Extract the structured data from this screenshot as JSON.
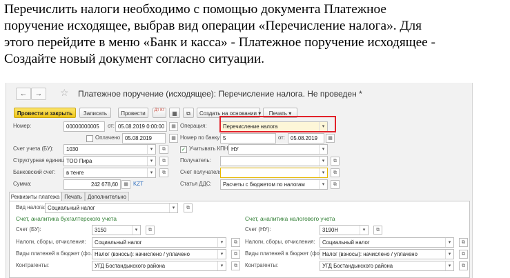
{
  "intro": {
    "line1": "Перечислить налоги необходимо с помощью документа Платежное",
    "line2": "поручение исходящее, выбрав вид операции «Перечисление налога». Для",
    "line3": "этого перейдите в меню «Банк и касса» - Платежное поручение исходящее -",
    "line4": "Создайте новый документ согласно ситуации."
  },
  "window": {
    "title": "Платежное поручение (исходящее): Перечисление налога. Не проведен *",
    "back": "←",
    "forward": "→",
    "star": "☆"
  },
  "toolbar": {
    "post_close": "Провести и закрыть",
    "save": "Записать",
    "post": "Провести",
    "dt_kt": "Дт Кт",
    "create_based": "Создать на основании",
    "print": "Печать"
  },
  "form": {
    "number_label": "Номер:",
    "number": "00000000005",
    "from_label": "от:",
    "date": "05.08.2019  0:00:00",
    "operation_label": "Операция:",
    "operation": "Перечисление налога",
    "paid_label": "Оплачено",
    "paid_date": "05.08.2019",
    "bank_number_label": "Номер по банку:",
    "bank_number": "5",
    "bank_from_label": "от:",
    "bank_date": "05.08.2019",
    "account_label": "Счет учета (БУ):",
    "account": "1030",
    "kpn_label": "Учитывать КПН",
    "kpn": "НУ",
    "unit_label": "Структурная единица:",
    "unit": "ТОО  Пира",
    "recipient_label": "Получатель:",
    "recipient": "",
    "bank_account_label": "Банковский счет:",
    "bank_account": "в тенге",
    "recipient_account_label": "Счет получателя:",
    "recipient_account": "",
    "sum_label": "Сумма:",
    "sum": "242 678,60",
    "currency": "KZT",
    "dds_label": "Статья ДДС:",
    "dds": "Расчеты с бюджетом по налогам"
  },
  "tabs": [
    "Реквизиты платежа",
    "Печать",
    "Дополнительно"
  ],
  "details": {
    "tax_type_label": "Вид налога:",
    "tax_type": "Социальный налог",
    "left_title": "Счет, аналитика бухгалтерского учета",
    "right_title": "Счет, аналитика налогового учета",
    "bu_account_label": "Счет (БУ):",
    "bu_account": "3150",
    "nu_account_label": "Счет (НУ):",
    "nu_account": "3190Н",
    "taxes_label": "Налоги, сборы, отчисления:",
    "taxes_left": "Социальный налог",
    "taxes_right": "Социальный налог",
    "payment_type_label": "Виды платежей в бюджет (фо...",
    "payment_type_left": "Налог (взносы): начислено / уплачено",
    "payment_type_right": "Налог (взносы): начислено / уплачено",
    "counterparty_label": "Контрагенты:",
    "counterparty_left": "УГД Бостандыкского района",
    "counterparty_right": "УГД Бостандыкского района"
  },
  "icons": {
    "dropdown": "▾",
    "select": "…",
    "open": "⧉",
    "calendar": "▦",
    "check": "✓"
  }
}
